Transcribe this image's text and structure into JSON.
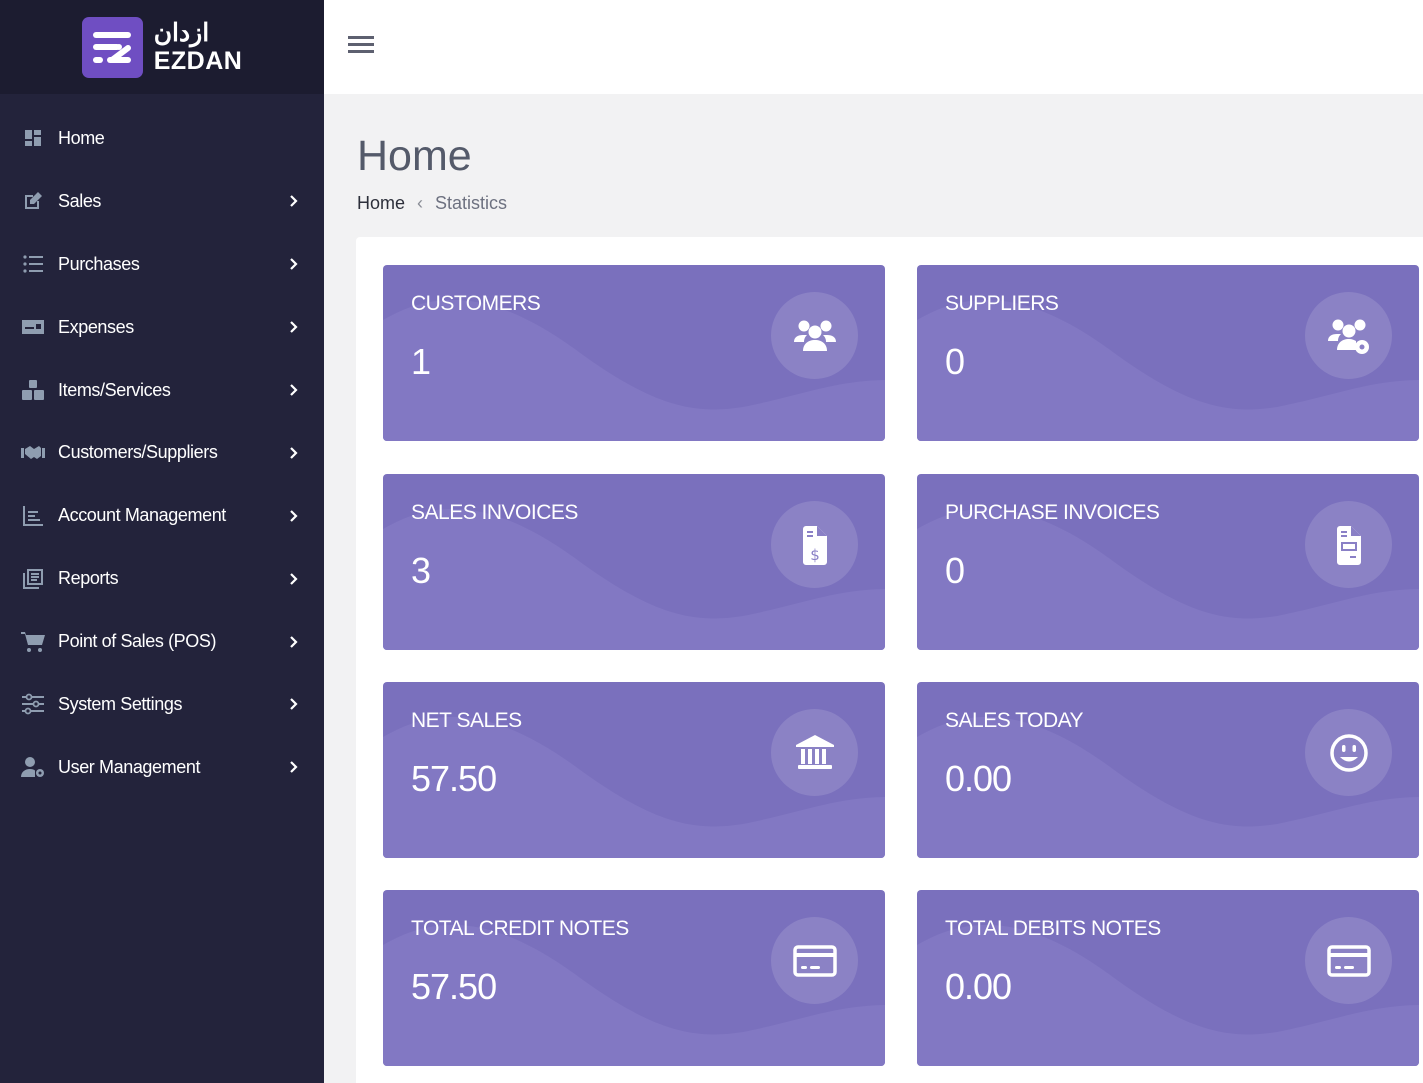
{
  "brand": {
    "arabic_name": "ازدان",
    "english_name": "EZDAN",
    "logo_color": "#6f4ec2"
  },
  "sidebar": {
    "items": [
      {
        "label": "Home",
        "icon": "dashboard-icon",
        "has_submenu": false
      },
      {
        "label": "Sales",
        "icon": "edit-icon",
        "has_submenu": true
      },
      {
        "label": "Purchases",
        "icon": "list-icon",
        "has_submenu": true
      },
      {
        "label": "Expenses",
        "icon": "id-card-icon",
        "has_submenu": true
      },
      {
        "label": "Items/Services",
        "icon": "boxes-icon",
        "has_submenu": true
      },
      {
        "label": "Customers/Suppliers",
        "icon": "handshake-icon",
        "has_submenu": true
      },
      {
        "label": "Account Management",
        "icon": "chart-lines-icon",
        "has_submenu": true
      },
      {
        "label": "Reports",
        "icon": "documents-icon",
        "has_submenu": true
      },
      {
        "label": "Point of Sales (POS)",
        "icon": "cart-icon",
        "has_submenu": true
      },
      {
        "label": "System Settings",
        "icon": "sliders-icon",
        "has_submenu": true
      },
      {
        "label": "User Management",
        "icon": "user-gear-icon",
        "has_submenu": true
      }
    ]
  },
  "header": {
    "menu_icon": "hamburger-icon"
  },
  "page": {
    "title": "Home",
    "breadcrumb": {
      "home": "Home",
      "separator": "‹",
      "current": "Statistics"
    }
  },
  "stats": {
    "card_color": "#7a70bd",
    "cards": [
      {
        "title": "CUSTOMERS",
        "value": "1",
        "icon": "users-icon"
      },
      {
        "title": "SUPPLIERS",
        "value": "0",
        "icon": "users-gear-icon"
      },
      {
        "title": "SALES INVOICES",
        "value": "3",
        "icon": "invoice-dollar-icon"
      },
      {
        "title": "PURCHASE INVOICES",
        "value": "0",
        "icon": "invoice-icon"
      },
      {
        "title": "NET SALES",
        "value": "57.50",
        "icon": "bank-icon"
      },
      {
        "title": "SALES TODAY",
        "value": "0.00",
        "icon": "smile-icon"
      },
      {
        "title": "TOTAL CREDIT NOTES",
        "value": "57.50",
        "icon": "credit-card-icon"
      },
      {
        "title": "TOTAL DEBITS NOTES",
        "value": "0.00",
        "icon": "credit-card-icon"
      }
    ]
  }
}
